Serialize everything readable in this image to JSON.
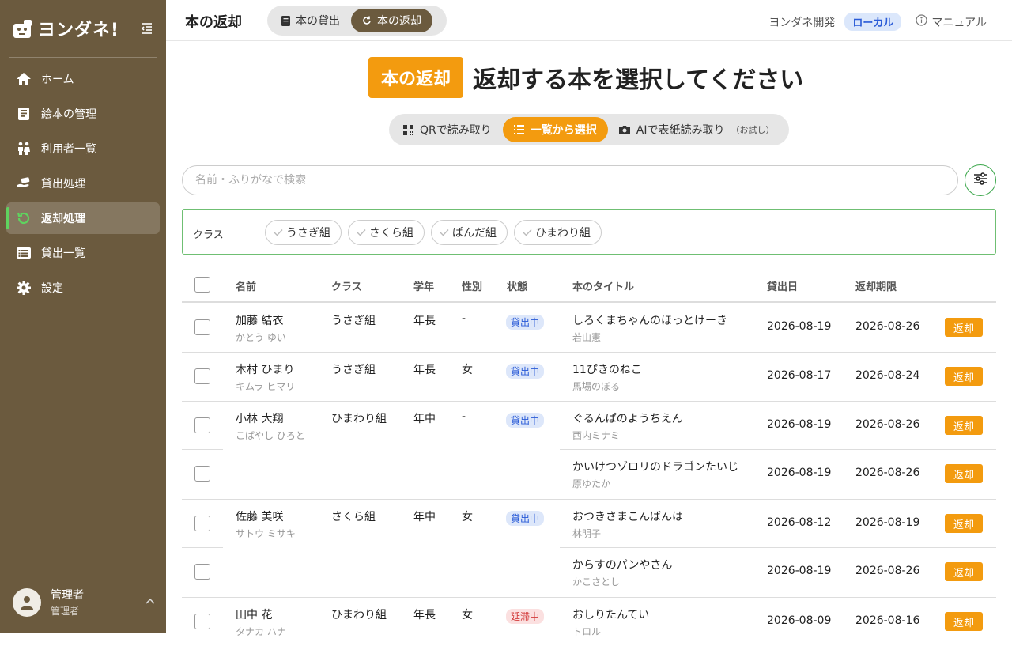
{
  "app": {
    "logo_text": "ヨンダネ!"
  },
  "sidebar": {
    "items": [
      {
        "label": "ホーム",
        "icon": "home-icon"
      },
      {
        "label": "絵本の管理",
        "icon": "book-icon"
      },
      {
        "label": "利用者一覧",
        "icon": "people-icon"
      },
      {
        "label": "貸出処理",
        "icon": "hand-book-icon"
      },
      {
        "label": "返却処理",
        "icon": "return-icon",
        "active": true
      },
      {
        "label": "貸出一覧",
        "icon": "list-icon"
      },
      {
        "label": "設定",
        "icon": "gear-icon"
      }
    ],
    "user": {
      "name": "管理者",
      "role": "管理者"
    }
  },
  "header": {
    "title": "本の返却",
    "seg_lend": "本の貸出",
    "seg_return": "本の返却",
    "org": "ヨンダネ開発",
    "env_badge": "ローカル",
    "manual": "マニュアル"
  },
  "hero": {
    "tag": "本の返却",
    "text": "返却する本を選択してください"
  },
  "modes": {
    "qr": "QRで読み取り",
    "list": "一覧から選択",
    "ai": "AIで表紙読み取り",
    "ai_note": "（お試し）"
  },
  "search": {
    "placeholder": "名前・ふりがなで検索"
  },
  "classes": {
    "label": "クラス",
    "chips": [
      "うさぎ組",
      "さくら組",
      "ぱんだ組",
      "ひまわり組"
    ]
  },
  "table": {
    "headers": {
      "name": "名前",
      "class": "クラス",
      "grade": "学年",
      "gender": "性別",
      "status": "状態",
      "title": "本のタイトル",
      "lent": "貸出日",
      "due": "返却期限"
    },
    "return_label": "返却",
    "rows": [
      {
        "name": "加藤 結衣",
        "kana": "かとう ゆい",
        "class": "うさぎ組",
        "grade": "年長",
        "gender": "-",
        "status": "貸出中",
        "book": "しろくまちゃんのほっとけーき",
        "author": "若山憲",
        "lent": "2026-08-19",
        "due": "2026-08-26"
      },
      {
        "name": "木村 ひまり",
        "kana": "キムラ ヒマリ",
        "class": "うさぎ組",
        "grade": "年長",
        "gender": "女",
        "status": "貸出中",
        "book": "11ぴきのねこ",
        "author": "馬場のぼる",
        "lent": "2026-08-17",
        "due": "2026-08-24"
      },
      {
        "name": "小林 大翔",
        "kana": "こばやし ひろと",
        "class": "ひまわり組",
        "grade": "年中",
        "gender": "-",
        "status": "貸出中",
        "book": "ぐるんぱのようちえん",
        "author": "西内ミナミ",
        "lent": "2026-08-19",
        "due": "2026-08-26"
      },
      {
        "book": "かいけつゾロリのドラゴンたいじ",
        "author": "原ゆたか",
        "lent": "2026-08-19",
        "due": "2026-08-26"
      },
      {
        "name": "佐藤 美咲",
        "kana": "サトウ ミサキ",
        "class": "さくら組",
        "grade": "年中",
        "gender": "女",
        "status": "貸出中",
        "book": "おつきさまこんばんは",
        "author": "林明子",
        "lent": "2026-08-12",
        "due": "2026-08-19"
      },
      {
        "book": "からすのパンやさん",
        "author": "かこさとし",
        "lent": "2026-08-19",
        "due": "2026-08-26"
      },
      {
        "name": "田中 花",
        "kana": "タナカ ハナ",
        "class": "ひまわり組",
        "grade": "年長",
        "gender": "女",
        "status": "延滞中",
        "book": "おしりたんてい",
        "author": "トロル",
        "lent": "2026-08-09",
        "due": "2026-08-16"
      }
    ]
  },
  "colors": {
    "sidebar": "#6b5a3e",
    "accent": "#f39b0f",
    "active_bar": "#5fd35f",
    "filter_border": "#3aa64a"
  }
}
